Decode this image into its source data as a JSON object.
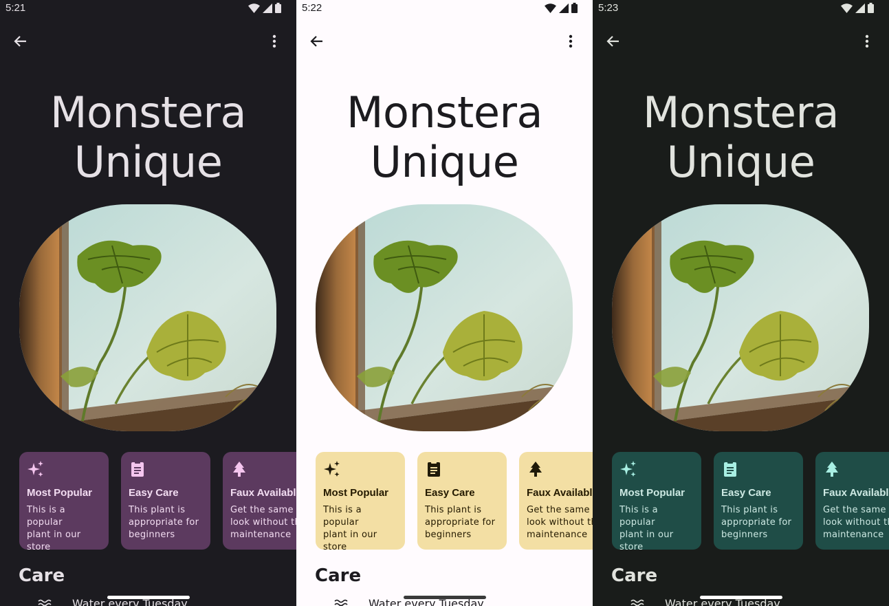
{
  "screens": [
    {
      "theme": "dark-purple",
      "status": {
        "time": "5:21"
      },
      "title": {
        "line1": "Monstera",
        "line2": "Unique"
      },
      "cards": [
        {
          "icon": "sparkle-icon",
          "title": "Most Popular",
          "desc": [
            "This is a popular",
            "plant in our store"
          ]
        },
        {
          "icon": "clipboard-icon",
          "title": "Easy Care",
          "desc": [
            "This plant is",
            "appropriate for",
            "beginners"
          ]
        },
        {
          "icon": "tree-icon",
          "title": "Faux Available",
          "desc": [
            "Get the same",
            "look without the",
            "maintenance"
          ]
        }
      ],
      "section_title": "Care",
      "care_item": "Water every Tuesday",
      "colors": {
        "bg": "#1c1b20",
        "text": "#e6e1e6",
        "card": "#5c3a5f",
        "card_text": "#f3ddf2",
        "icon": "#f5c6ef",
        "handle": "#ffffff"
      }
    },
    {
      "theme": "light-yellow",
      "status": {
        "time": "5:22"
      },
      "title": {
        "line1": "Monstera",
        "line2": "Unique"
      },
      "cards": [
        {
          "icon": "sparkle-icon",
          "title": "Most Popular",
          "desc": [
            "This is a popular",
            "plant in our store"
          ]
        },
        {
          "icon": "clipboard-icon",
          "title": "Easy Care",
          "desc": [
            "This plant is",
            "appropriate for",
            "beginners"
          ]
        },
        {
          "icon": "tree-icon",
          "title": "Faux Available",
          "desc": [
            "Get the same",
            "look without the",
            "maintenance"
          ]
        }
      ],
      "section_title": "Care",
      "care_item": "Water every Tuesday",
      "colors": {
        "bg": "#fffbfe",
        "text": "#1c1b1f",
        "card": "#f3dfa4",
        "card_text": "#241a00",
        "icon": "#1f1a09",
        "handle": "#3a3a3a"
      }
    },
    {
      "theme": "dark-green",
      "status": {
        "time": "5:23"
      },
      "title": {
        "line1": "Monstera",
        "line2": "Unique"
      },
      "cards": [
        {
          "icon": "sparkle-icon",
          "title": "Most Popular",
          "desc": [
            "This is a popular",
            "plant in our store"
          ]
        },
        {
          "icon": "clipboard-icon",
          "title": "Easy Care",
          "desc": [
            "This plant is",
            "appropriate for",
            "beginners"
          ]
        },
        {
          "icon": "tree-icon",
          "title": "Faux Available",
          "desc": [
            "Get the same",
            "look without the",
            "maintenance"
          ]
        }
      ],
      "section_title": "Care",
      "care_item": "Water every Tuesday",
      "colors": {
        "bg": "#191c1a",
        "text": "#e1e3de",
        "card": "#1f4d47",
        "card_text": "#cde9e3",
        "icon": "#a8efe3",
        "handle": "#ffffff"
      }
    }
  ]
}
